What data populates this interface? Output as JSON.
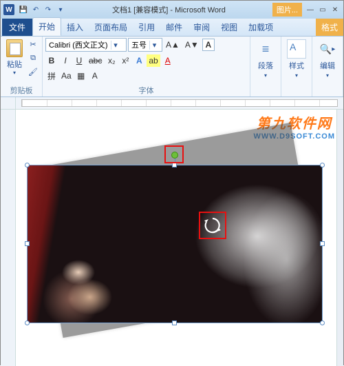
{
  "title_doc": "文档1",
  "title_mode": "[兼容模式]",
  "title_app": "Microsoft Word",
  "contextual_tab_header": "图片...",
  "qat": {
    "save": "💾",
    "undo": "↶",
    "redo": "↷",
    "more": "▾"
  },
  "winbtns": {
    "min": "—",
    "max": "▭",
    "close": "✕"
  },
  "tabs": {
    "file": "文件",
    "home": "开始",
    "insert": "插入",
    "layout": "页面布局",
    "references": "引用",
    "mailings": "邮件",
    "review": "审阅",
    "view": "视图",
    "addins": "加载项",
    "format": "格式"
  },
  "ribbon": {
    "clipboard": {
      "paste": "粘贴",
      "label": "剪贴板",
      "cut": "✂",
      "copy": "⧉",
      "painter": "🖌"
    },
    "font": {
      "name": "Calibri (西文正文)",
      "size": "五号",
      "grow": "A▲",
      "shrink": "A▼",
      "clear": "Aa",
      "bold": "B",
      "italic": "I",
      "underline": "U",
      "strike": "abc",
      "sub": "x₂",
      "sup": "x²",
      "case": "Aa",
      "highlight": "ab",
      "color": "A",
      "phonetic": "拼",
      "border": "▦",
      "effects": "A",
      "label": "字体"
    },
    "paragraph": {
      "btn": "段落",
      "icon": "≡"
    },
    "styles": {
      "btn": "样式"
    },
    "editing": {
      "btn": "编辑",
      "icon": "🔍"
    }
  },
  "watermark": {
    "line1": "第九软件网",
    "line2": "WWW.D9SOFT.COM"
  },
  "icons": {
    "dropdown": "▾"
  }
}
